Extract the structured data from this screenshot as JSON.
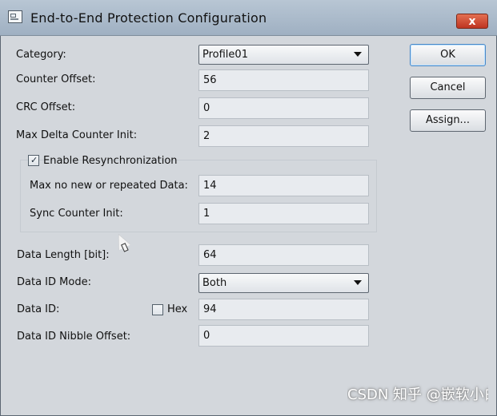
{
  "window": {
    "title": "End-to-End Protection Configuration",
    "close_symbol": "x"
  },
  "form": {
    "category": {
      "label": "Category:",
      "value": "Profile01"
    },
    "counter_offset": {
      "label": "Counter Offset:",
      "value": "56"
    },
    "crc_offset": {
      "label": "CRC Offset:",
      "value": "0"
    },
    "max_delta_counter_init": {
      "label": "Max Delta Counter Init:",
      "value": "2"
    },
    "enable_resynchronization": {
      "label": "Enable Resynchronization",
      "checked": true
    },
    "max_no_new_or_repeated_data": {
      "label": "Max no new or repeated Data:",
      "value": "14"
    },
    "sync_counter_init": {
      "label": "Sync Counter Init:",
      "value": "1"
    },
    "data_length": {
      "label": "Data Length [bit]:",
      "value": "64"
    },
    "data_id_mode": {
      "label": "Data ID Mode:",
      "value": "Both"
    },
    "data_id": {
      "label": "Data ID:",
      "value": "94"
    },
    "hex": {
      "label": "Hex",
      "checked": false
    },
    "data_id_nibble_offset": {
      "label": "Data ID Nibble Offset:",
      "value": "0"
    }
  },
  "buttons": {
    "ok": "OK",
    "cancel": "Cancel",
    "assign": "Assign..."
  },
  "watermark": "CSDN 知乎 @嵌软小白侧",
  "colors": {
    "title_bar": "#b8c6d4",
    "window_bg": "#d3d7dc",
    "close_button": "#d14b32",
    "input_bg": "#e8ebef"
  },
  "icons": {
    "app": "window-app-icon",
    "close": "close-icon",
    "combo_arrow": "chevron-down-icon",
    "check": "checkmark-icon",
    "cursor": "mouse-pointer-icon"
  }
}
